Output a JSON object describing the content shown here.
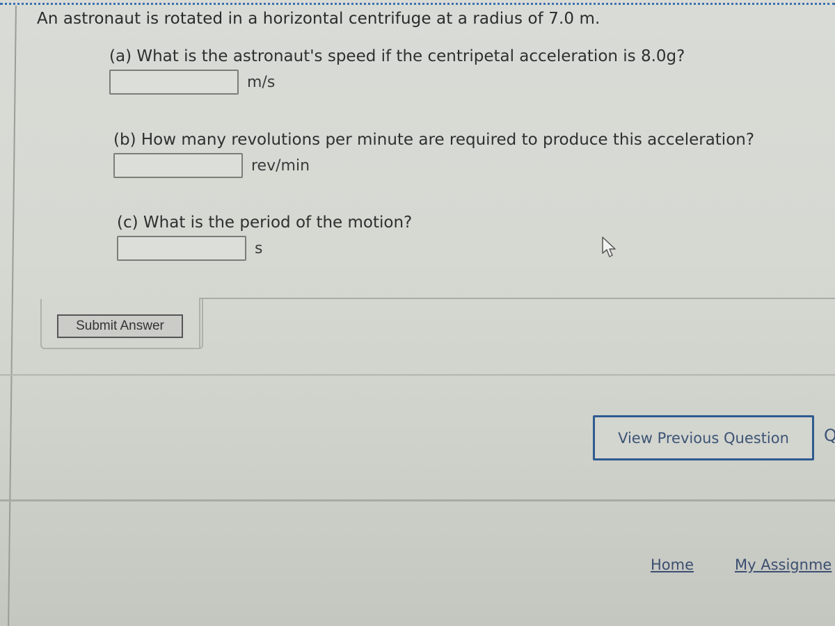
{
  "question": {
    "intro": "An astronaut is rotated in a horizontal centrifuge at a radius of 7.0 m.",
    "parts": [
      {
        "label": "(a) What is the astronaut's speed if the centripetal acceleration is 8.0g?",
        "value": "",
        "placeholder": "",
        "unit": "m/s"
      },
      {
        "label": "(b) How many revolutions per minute are required to produce this acceleration?",
        "value": "",
        "placeholder": "",
        "unit": "rev/min"
      },
      {
        "label": "(c) What is the period of the motion?",
        "value": "",
        "placeholder": "",
        "unit": "s"
      }
    ]
  },
  "actions": {
    "submit_label": "Submit Answer",
    "prev_label": "View Previous Question",
    "next_partial": "Q"
  },
  "footer": {
    "links": [
      "Home",
      "My Assignme"
    ]
  },
  "colors": {
    "link": "#3c4e70",
    "prev_border": "#2e5a8f",
    "dotted_rule": "#3a6fb0"
  },
  "icons": {
    "cursor": "mouse-pointer-arrow"
  }
}
